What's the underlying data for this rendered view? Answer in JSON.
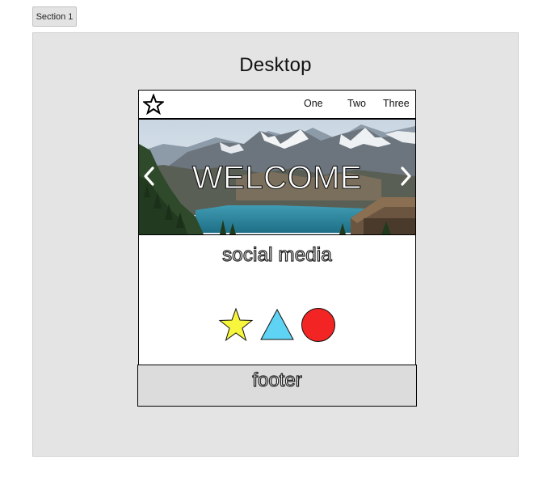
{
  "toolbar": {
    "section_label": "Section 1"
  },
  "frame": {
    "title": "Desktop",
    "background": "#e4e4e4"
  },
  "nav": {
    "logo_icon": "star-outline-icon",
    "links": [
      "One",
      "Two",
      "Three"
    ]
  },
  "hero": {
    "title": "WELCOME",
    "image": "mountain-lake-landscape",
    "prev_icon": "chevron-left-icon",
    "next_icon": "chevron-right-icon"
  },
  "social": {
    "heading": "social media",
    "icons": [
      {
        "name": "star-icon",
        "color": "#f7f53c"
      },
      {
        "name": "triangle-icon",
        "color": "#5fd3f3"
      },
      {
        "name": "circle-icon",
        "color": "#f32424"
      }
    ]
  },
  "footer": {
    "label": "footer"
  }
}
